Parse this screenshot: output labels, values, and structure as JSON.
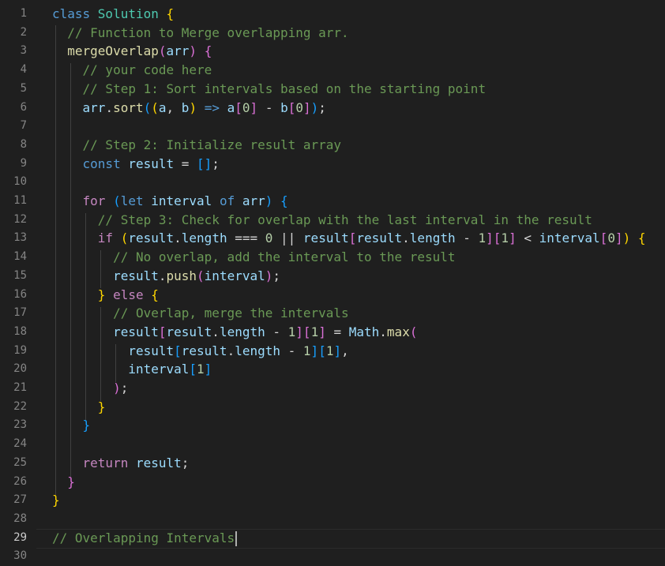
{
  "editor": {
    "active_line": 29,
    "lines": [
      {
        "n": "1",
        "tokens": [
          [
            "kw",
            "class "
          ],
          [
            "cls",
            "Solution "
          ],
          [
            "b1",
            "{"
          ]
        ]
      },
      {
        "n": "2",
        "tokens": [
          [
            "plain",
            "  "
          ],
          [
            "cmt",
            "// Function to Merge overlapping arr."
          ]
        ]
      },
      {
        "n": "3",
        "tokens": [
          [
            "plain",
            "  "
          ],
          [
            "fn",
            "mergeOverlap"
          ],
          [
            "b2",
            "("
          ],
          [
            "var",
            "arr"
          ],
          [
            "b2",
            ")"
          ],
          [
            "plain",
            " "
          ],
          [
            "b2",
            "{"
          ]
        ]
      },
      {
        "n": "4",
        "tokens": [
          [
            "plain",
            "    "
          ],
          [
            "cmt",
            "// your code here"
          ]
        ]
      },
      {
        "n": "5",
        "tokens": [
          [
            "plain",
            "    "
          ],
          [
            "cmt",
            "// Step 1: Sort intervals based on the starting point"
          ]
        ]
      },
      {
        "n": "6",
        "tokens": [
          [
            "plain",
            "    "
          ],
          [
            "var",
            "arr"
          ],
          [
            "plain",
            "."
          ],
          [
            "fn",
            "sort"
          ],
          [
            "b3",
            "("
          ],
          [
            "b1",
            "("
          ],
          [
            "var",
            "a"
          ],
          [
            "plain",
            ", "
          ],
          [
            "var",
            "b"
          ],
          [
            "b1",
            ")"
          ],
          [
            "plain",
            " "
          ],
          [
            "kw",
            "=>"
          ],
          [
            "plain",
            " "
          ],
          [
            "var",
            "a"
          ],
          [
            "b2",
            "["
          ],
          [
            "num",
            "0"
          ],
          [
            "b2",
            "]"
          ],
          [
            "plain",
            " - "
          ],
          [
            "var",
            "b"
          ],
          [
            "b2",
            "["
          ],
          [
            "num",
            "0"
          ],
          [
            "b2",
            "]"
          ],
          [
            "b3",
            ")"
          ],
          [
            "plain",
            ";"
          ]
        ]
      },
      {
        "n": "7",
        "tokens": []
      },
      {
        "n": "8",
        "tokens": [
          [
            "plain",
            "    "
          ],
          [
            "cmt",
            "// Step 2: Initialize result array"
          ]
        ]
      },
      {
        "n": "9",
        "tokens": [
          [
            "plain",
            "    "
          ],
          [
            "kw",
            "const "
          ],
          [
            "var",
            "result"
          ],
          [
            "plain",
            " = "
          ],
          [
            "b3",
            "[]"
          ],
          [
            "plain",
            ";"
          ]
        ]
      },
      {
        "n": "10",
        "tokens": []
      },
      {
        "n": "11",
        "tokens": [
          [
            "plain",
            "    "
          ],
          [
            "cf",
            "for "
          ],
          [
            "b3",
            "("
          ],
          [
            "kw",
            "let "
          ],
          [
            "var",
            "interval"
          ],
          [
            "plain",
            " "
          ],
          [
            "kw",
            "of "
          ],
          [
            "var",
            "arr"
          ],
          [
            "b3",
            ")"
          ],
          [
            "plain",
            " "
          ],
          [
            "b3",
            "{"
          ]
        ]
      },
      {
        "n": "12",
        "tokens": [
          [
            "plain",
            "      "
          ],
          [
            "cmt",
            "// Step 3: Check for overlap with the last interval in the result"
          ]
        ]
      },
      {
        "n": "13",
        "tokens": [
          [
            "plain",
            "      "
          ],
          [
            "cf",
            "if "
          ],
          [
            "b1",
            "("
          ],
          [
            "var",
            "result"
          ],
          [
            "plain",
            "."
          ],
          [
            "var",
            "length"
          ],
          [
            "plain",
            " === "
          ],
          [
            "num",
            "0"
          ],
          [
            "plain",
            " || "
          ],
          [
            "var",
            "result"
          ],
          [
            "b2",
            "["
          ],
          [
            "var",
            "result"
          ],
          [
            "plain",
            "."
          ],
          [
            "var",
            "length"
          ],
          [
            "plain",
            " - "
          ],
          [
            "num",
            "1"
          ],
          [
            "b2",
            "]"
          ],
          [
            "b2",
            "["
          ],
          [
            "num",
            "1"
          ],
          [
            "b2",
            "]"
          ],
          [
            "plain",
            " < "
          ],
          [
            "var",
            "interval"
          ],
          [
            "b2",
            "["
          ],
          [
            "num",
            "0"
          ],
          [
            "b2",
            "]"
          ],
          [
            "b1",
            ")"
          ],
          [
            "plain",
            " "
          ],
          [
            "b1",
            "{"
          ]
        ]
      },
      {
        "n": "14",
        "tokens": [
          [
            "plain",
            "        "
          ],
          [
            "cmt",
            "// No overlap, add the interval to the result"
          ]
        ]
      },
      {
        "n": "15",
        "tokens": [
          [
            "plain",
            "        "
          ],
          [
            "var",
            "result"
          ],
          [
            "plain",
            "."
          ],
          [
            "fn",
            "push"
          ],
          [
            "b2",
            "("
          ],
          [
            "var",
            "interval"
          ],
          [
            "b2",
            ")"
          ],
          [
            "plain",
            ";"
          ]
        ]
      },
      {
        "n": "16",
        "tokens": [
          [
            "plain",
            "      "
          ],
          [
            "b1",
            "}"
          ],
          [
            "plain",
            " "
          ],
          [
            "cf",
            "else "
          ],
          [
            "b1",
            "{"
          ]
        ]
      },
      {
        "n": "17",
        "tokens": [
          [
            "plain",
            "        "
          ],
          [
            "cmt",
            "// Overlap, merge the intervals"
          ]
        ]
      },
      {
        "n": "18",
        "tokens": [
          [
            "plain",
            "        "
          ],
          [
            "var",
            "result"
          ],
          [
            "b2",
            "["
          ],
          [
            "var",
            "result"
          ],
          [
            "plain",
            "."
          ],
          [
            "var",
            "length"
          ],
          [
            "plain",
            " - "
          ],
          [
            "num",
            "1"
          ],
          [
            "b2",
            "]"
          ],
          [
            "b2",
            "["
          ],
          [
            "num",
            "1"
          ],
          [
            "b2",
            "]"
          ],
          [
            "plain",
            " = "
          ],
          [
            "var",
            "Math"
          ],
          [
            "plain",
            "."
          ],
          [
            "fn",
            "max"
          ],
          [
            "b2",
            "("
          ]
        ]
      },
      {
        "n": "19",
        "tokens": [
          [
            "plain",
            "          "
          ],
          [
            "var",
            "result"
          ],
          [
            "b3",
            "["
          ],
          [
            "var",
            "result"
          ],
          [
            "plain",
            "."
          ],
          [
            "var",
            "length"
          ],
          [
            "plain",
            " - "
          ],
          [
            "num",
            "1"
          ],
          [
            "b3",
            "]"
          ],
          [
            "b3",
            "["
          ],
          [
            "num",
            "1"
          ],
          [
            "b3",
            "]"
          ],
          [
            "plain",
            ","
          ]
        ]
      },
      {
        "n": "20",
        "tokens": [
          [
            "plain",
            "          "
          ],
          [
            "var",
            "interval"
          ],
          [
            "b3",
            "["
          ],
          [
            "num",
            "1"
          ],
          [
            "b3",
            "]"
          ]
        ]
      },
      {
        "n": "21",
        "tokens": [
          [
            "plain",
            "        "
          ],
          [
            "b2",
            ")"
          ],
          [
            "plain",
            ";"
          ]
        ]
      },
      {
        "n": "22",
        "tokens": [
          [
            "plain",
            "      "
          ],
          [
            "b1",
            "}"
          ]
        ]
      },
      {
        "n": "23",
        "tokens": [
          [
            "plain",
            "    "
          ],
          [
            "b3",
            "}"
          ]
        ]
      },
      {
        "n": "24",
        "tokens": []
      },
      {
        "n": "25",
        "tokens": [
          [
            "plain",
            "    "
          ],
          [
            "cf",
            "return "
          ],
          [
            "var",
            "result"
          ],
          [
            "plain",
            ";"
          ]
        ]
      },
      {
        "n": "26",
        "tokens": [
          [
            "plain",
            "  "
          ],
          [
            "b2",
            "}"
          ]
        ]
      },
      {
        "n": "27",
        "tokens": [
          [
            "b1",
            "}"
          ]
        ]
      },
      {
        "n": "28",
        "tokens": []
      },
      {
        "n": "29",
        "tokens": [
          [
            "cmt",
            "// Overlapping Intervals"
          ]
        ]
      },
      {
        "n": "30",
        "tokens": []
      }
    ]
  }
}
